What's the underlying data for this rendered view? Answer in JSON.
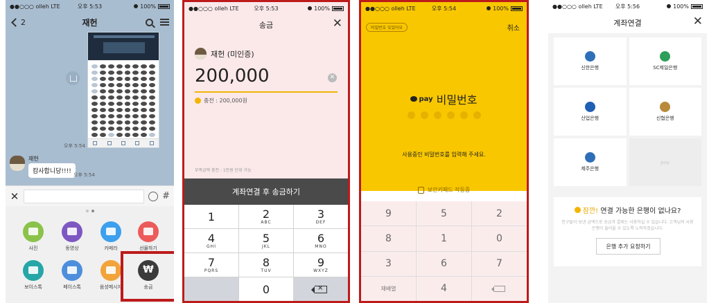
{
  "screen1": {
    "status": {
      "carrier": "●●○○○ olleh  LTE",
      "time": "오후 5:53",
      "battery": "100%"
    },
    "back_count": "2",
    "title": "재헌",
    "time1": "오후 5:54",
    "sender": "재헌",
    "message": "캄사합니당!!!!",
    "time2": "오후 5:54",
    "tray": [
      {
        "label": "사진",
        "color": "#8bc34a"
      },
      {
        "label": "동영상",
        "color": "#7e57c2"
      },
      {
        "label": "카메라",
        "color": "#3ca0ee"
      },
      {
        "label": "선물하기",
        "color": "#ec5a5a"
      },
      {
        "label": "보이스톡",
        "color": "#26a6a6"
      },
      {
        "label": "페이스톡",
        "color": "#4e8fdc"
      },
      {
        "label": "음성메시지",
        "color": "#f2a33a"
      },
      {
        "label": "송금",
        "color": "#3b3b3b"
      }
    ],
    "won_symbol": "₩"
  },
  "screen2": {
    "status": {
      "carrier": "●●○○○ olleh  LTE",
      "time": "오후 5:53",
      "battery": "100%"
    },
    "title": "송금",
    "recipient": "재헌 (미인증)",
    "amount": "200,000",
    "charge": "충전 : 200,000원",
    "note": "부족금액 충전 : 1만원 단위 가능",
    "action": "계좌연결 후 송금하기",
    "keypad": [
      {
        "digit": "1",
        "letters": ""
      },
      {
        "digit": "2",
        "letters": "ABC"
      },
      {
        "digit": "3",
        "letters": "DEF"
      },
      {
        "digit": "4",
        "letters": "GHI"
      },
      {
        "digit": "5",
        "letters": "JKL"
      },
      {
        "digit": "6",
        "letters": "MNO"
      },
      {
        "digit": "7",
        "letters": "PQRS"
      },
      {
        "digit": "8",
        "letters": "TUV"
      },
      {
        "digit": "9",
        "letters": "WXYZ"
      },
      {
        "digit": "0",
        "letters": ""
      }
    ]
  },
  "screen3": {
    "status": {
      "carrier": "●●○○○ olleh  LTE",
      "time": "오후 5:54",
      "battery": "100%"
    },
    "forgot": "비밀번호 잊었어요",
    "cancel": "취소",
    "pay_mark": "pay",
    "pay_title": "비밀번호",
    "pw_digits": 6,
    "message": "사용중인 비밀번호를 입력해 주세요.",
    "secure": "보안키패드 작동중",
    "keypad": [
      "9",
      "5",
      "2",
      "8",
      "1",
      "0",
      "3",
      "6",
      "7",
      "재배열",
      "4"
    ]
  },
  "screen4": {
    "status": {
      "carrier": "●●○○○ olleh  LTE",
      "time": "오후 5:56",
      "battery": "100%"
    },
    "title": "계좌연결",
    "banks": [
      {
        "name": "신한은행",
        "color": "#2f6fb7"
      },
      {
        "name": "SC제일은행",
        "color": "#2e9e5b"
      },
      {
        "name": "산업은행",
        "color": "#1f5fb4"
      },
      {
        "name": "신협은행",
        "color": "#b88a3a"
      },
      {
        "name": "제주은행",
        "color": "#2f6fb7"
      }
    ],
    "empty_slot": "pay",
    "ask_highlight": "잠깐!",
    "ask_title": "연결 가능한 은행이 없나요?",
    "ask_desc": "친구들이 보낸 금액으로 송금과 결제는 사용하실 수 있습니다. 고객님의 사용 은행이 들어올 수 있도록 노력하겠습니다.",
    "ask_button": "은행 추가 요청하기"
  }
}
